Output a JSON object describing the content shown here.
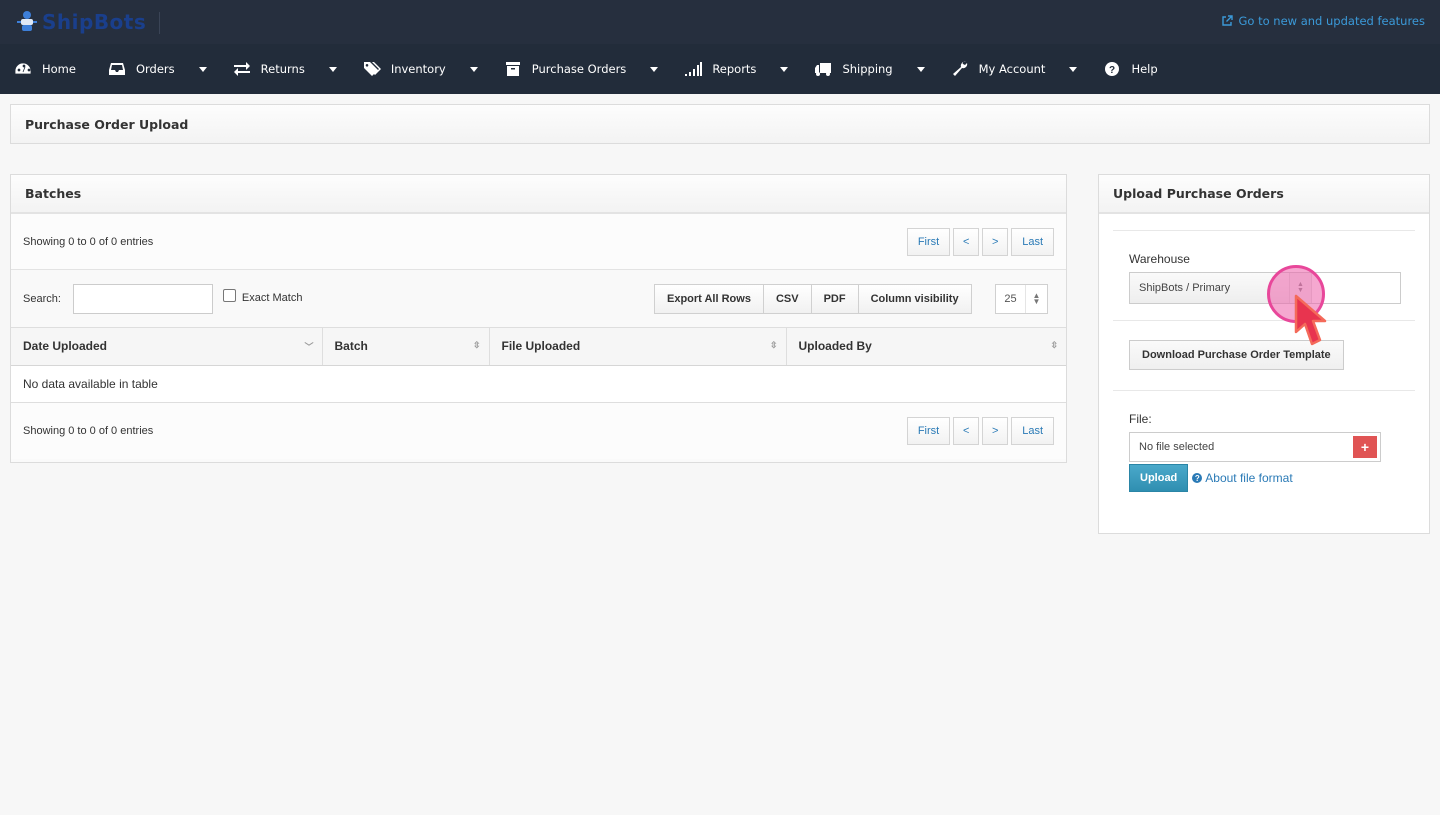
{
  "brand": {
    "name": "ShipBots",
    "logo_icon": "robot-logo-icon"
  },
  "topbar": {
    "new_features_link": "Go to new and updated features",
    "new_features_icon": "external-link-icon"
  },
  "nav": {
    "items": [
      {
        "label": "Home",
        "icon": "dashboard-icon",
        "dropdown": false
      },
      {
        "label": "Orders",
        "icon": "inbox-icon",
        "dropdown": true
      },
      {
        "label": "Returns",
        "icon": "exchange-icon",
        "dropdown": true
      },
      {
        "label": "Inventory",
        "icon": "tags-icon",
        "dropdown": true
      },
      {
        "label": "Purchase Orders",
        "icon": "archive-box-icon",
        "dropdown": true
      },
      {
        "label": "Reports",
        "icon": "signal-bars-icon",
        "dropdown": true
      },
      {
        "label": "Shipping",
        "icon": "truck-icon",
        "dropdown": true
      },
      {
        "label": "My Account",
        "icon": "wrench-icon",
        "dropdown": true
      },
      {
        "label": "Help",
        "icon": "question-circle-icon",
        "dropdown": false
      }
    ]
  },
  "page": {
    "title": "Purchase Order Upload"
  },
  "batches": {
    "title": "Batches",
    "info_top": "Showing 0 to 0 of 0 entries",
    "info_bottom": "Showing 0 to 0 of 0 entries",
    "pager": {
      "first": "First",
      "prev": "<",
      "next": ">",
      "last": "Last"
    },
    "search_label": "Search:",
    "search_value": "",
    "exact_match_label": "Exact Match",
    "exact_match_checked": false,
    "buttons": {
      "export": "Export All Rows",
      "csv": "CSV",
      "pdf": "PDF",
      "colvis": "Column visibility"
    },
    "page_length": "25",
    "columns": [
      "Date Uploaded",
      "Batch",
      "File Uploaded",
      "Uploaded By"
    ],
    "empty_message": "No data available in table"
  },
  "upload_panel": {
    "title": "Upload Purchase Orders",
    "warehouse_label": "Warehouse",
    "warehouse_value": "ShipBots / Primary",
    "download_template": "Download Purchase Order Template",
    "file_label": "File:",
    "file_value": "No file selected",
    "file_add": "+",
    "upload_button": "Upload",
    "about_link": "About file format"
  },
  "colors": {
    "topbar": "#262f3e",
    "navbar": "#222c3a",
    "link": "#2a7ab6",
    "upload_btn": "#3b9dc0",
    "add_file": "#e05454",
    "cursor_highlight": "#e8479a"
  }
}
